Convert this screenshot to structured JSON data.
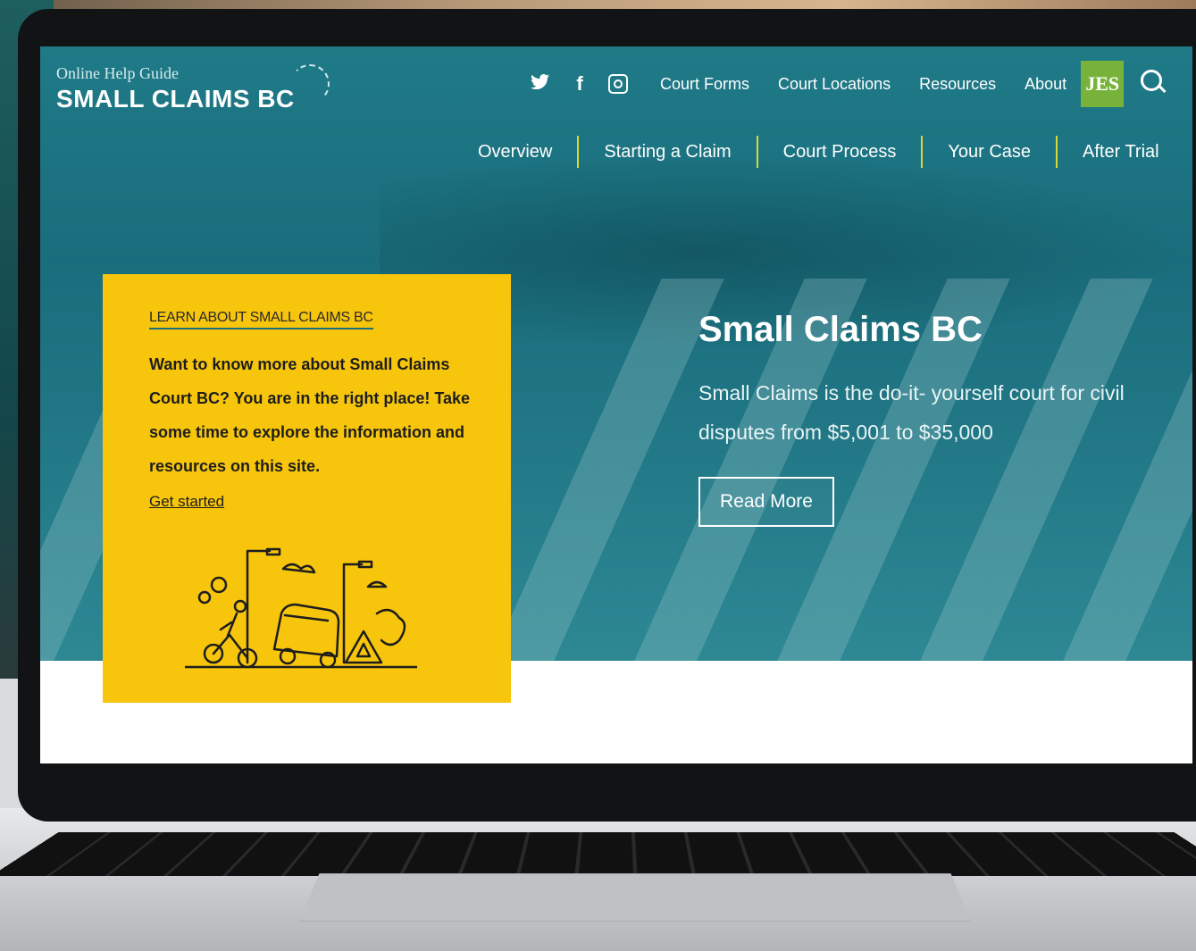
{
  "logo": {
    "kicker": "Online Help Guide",
    "title": "SMALL CLAIMS BC"
  },
  "social": {
    "twitter_glyph": "🐦",
    "facebook_glyph": "f"
  },
  "utility_nav": [
    "Court Forms",
    "Court Locations",
    "Resources",
    "About"
  ],
  "jes_badge": "JES",
  "main_nav": [
    "Overview",
    "Starting a Claim",
    "Court Process",
    "Your Case",
    "After Trial"
  ],
  "card": {
    "kicker": "LEARN ABOUT SMALL CLAIMS BC",
    "body": "Want to know more about Small Claims Court BC? You are in the right place! Take some time to explore the information and resources on this site.",
    "link": "Get started"
  },
  "hero": {
    "title": "Small Claims BC",
    "subtitle": "Small Claims is the do-it- yourself court for civil disputes from $5,001 to $35,000",
    "button": "Read More"
  },
  "colors": {
    "teal": "#1f7a87",
    "yellow": "#f7c50c",
    "jes_green": "#77b33a"
  }
}
